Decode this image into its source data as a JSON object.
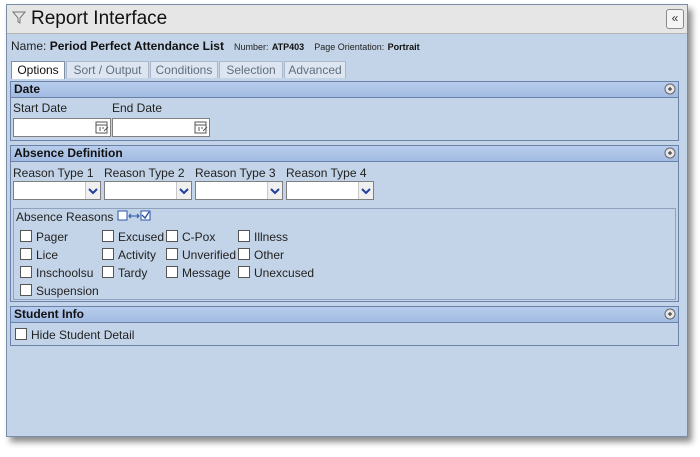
{
  "window": {
    "title": "Report Interface",
    "collapse_label": "«"
  },
  "report": {
    "name_label": "Name:",
    "name": "Period Perfect Attendance List",
    "number_label": "Number:",
    "number": "ATP403",
    "orientation_label": "Page Orientation:",
    "orientation": "Portrait"
  },
  "tabs": [
    "Options",
    "Sort / Output",
    "Conditions",
    "Selection",
    "Advanced"
  ],
  "date_section": {
    "title": "Date",
    "start_label": "Start Date",
    "start_value": "",
    "end_label": "End Date",
    "end_value": ""
  },
  "absence_section": {
    "title": "Absence Definition",
    "reason_types": [
      {
        "label": "Reason Type 1",
        "value": ""
      },
      {
        "label": "Reason Type 2",
        "value": ""
      },
      {
        "label": "Reason Type 3",
        "value": ""
      },
      {
        "label": "Reason Type 4",
        "value": ""
      }
    ],
    "reasons_label": "Absence Reasons",
    "reasons": [
      "Pager",
      "Excused",
      "C-Pox",
      "Illness",
      "Lice",
      "Activity",
      "Unverified",
      "Other",
      "Inschoolsu",
      "Tardy",
      "Message",
      "Unexcused",
      "Suspension"
    ]
  },
  "student_section": {
    "title": "Student Info",
    "hide_detail_label": "Hide Student Detail"
  },
  "colors": {
    "panel_bg": "#c3d4e8",
    "section_header": "#a2bbe2",
    "border": "#6b82a8"
  }
}
